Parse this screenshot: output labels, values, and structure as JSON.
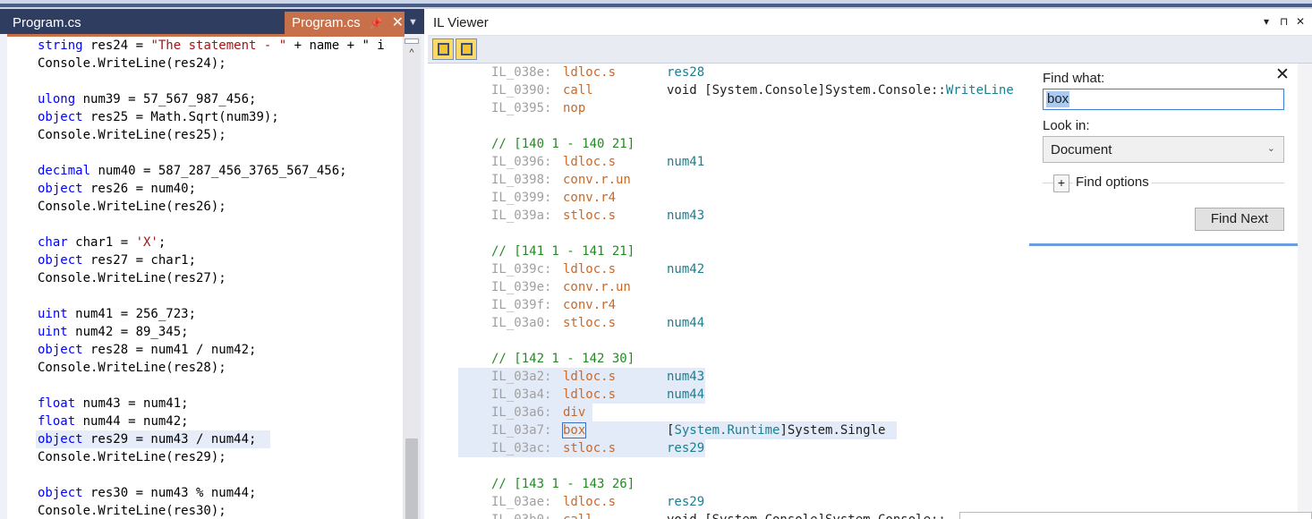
{
  "editor": {
    "tab_left": "Program.cs",
    "tab_active": "Program.cs",
    "lines": [
      {
        "kw": "string",
        "rest": " res24 = ",
        "str": "\"The statement - \"",
        "tail": " + name + \" i"
      },
      {
        "kw": "",
        "rest": "Console.WriteLine(res24);",
        "str": "",
        "tail": ""
      },
      {
        "kw": "",
        "rest": "",
        "str": "",
        "tail": ""
      },
      {
        "kw": "ulong",
        "rest": " num39 = 57_567_987_456;",
        "str": "",
        "tail": ""
      },
      {
        "kw": "object",
        "rest": " res25 = Math.Sqrt(num39);",
        "str": "",
        "tail": ""
      },
      {
        "kw": "",
        "rest": "Console.WriteLine(res25);",
        "str": "",
        "tail": ""
      },
      {
        "kw": "",
        "rest": "",
        "str": "",
        "tail": ""
      },
      {
        "kw": "decimal",
        "rest": " num40 = 587_287_456_3765_567_456;",
        "str": "",
        "tail": ""
      },
      {
        "kw": "object",
        "rest": " res26 = num40;",
        "str": "",
        "tail": ""
      },
      {
        "kw": "",
        "rest": "Console.WriteLine(res26);",
        "str": "",
        "tail": ""
      },
      {
        "kw": "",
        "rest": "",
        "str": "",
        "tail": ""
      },
      {
        "kw": "char",
        "rest": " char1 = ",
        "str": "'X'",
        "tail": ";"
      },
      {
        "kw": "object",
        "rest": " res27 = char1;",
        "str": "",
        "tail": ""
      },
      {
        "kw": "",
        "rest": "Console.WriteLine(res27);",
        "str": "",
        "tail": ""
      },
      {
        "kw": "",
        "rest": "",
        "str": "",
        "tail": ""
      },
      {
        "kw": "uint",
        "rest": " num41 = 256_723;",
        "str": "",
        "tail": ""
      },
      {
        "kw": "uint",
        "rest": " num42 = 89_345;",
        "str": "",
        "tail": ""
      },
      {
        "kw": "object",
        "rest": " res28 = num41 / num42;",
        "str": "",
        "tail": ""
      },
      {
        "kw": "",
        "rest": "Console.WriteLine(res28);",
        "str": "",
        "tail": ""
      },
      {
        "kw": "",
        "rest": "",
        "str": "",
        "tail": ""
      },
      {
        "kw": "float",
        "rest": " num43 = num41;",
        "str": "",
        "tail": ""
      },
      {
        "kw": "float",
        "rest": " num44 = num42;",
        "str": "",
        "tail": ""
      },
      {
        "kw": "object",
        "rest": " res29 = num43 / num44;",
        "str": "",
        "tail": ""
      },
      {
        "kw": "",
        "rest": "Console.WriteLine(res29);",
        "str": "",
        "tail": ""
      },
      {
        "kw": "",
        "rest": "",
        "str": "",
        "tail": ""
      },
      {
        "kw": "object",
        "rest": " res30 = num43 % num44;",
        "str": "",
        "tail": ""
      },
      {
        "kw": "",
        "rest": "Console.WriteLine(res30);",
        "str": "",
        "tail": ""
      }
    ]
  },
  "il_viewer": {
    "title": "IL Viewer",
    "title_controls": [
      "▾",
      "⊓",
      "✕"
    ],
    "lines": [
      {
        "type": "instr",
        "addr": "IL_038e:",
        "op": "ldloc.s",
        "arg": "res28",
        "argkind": "var"
      },
      {
        "type": "instr",
        "addr": "IL_0390:",
        "op": "call",
        "arg": "void [System.Console]System.Console::",
        "arg2": "WriteLine",
        "argkind": "txt"
      },
      {
        "type": "instr",
        "addr": "IL_0395:",
        "op": "nop",
        "arg": "",
        "argkind": "var"
      },
      {
        "type": "blank"
      },
      {
        "type": "comment",
        "text": "// [140 1 - 140 21]"
      },
      {
        "type": "instr",
        "addr": "IL_0396:",
        "op": "ldloc.s",
        "arg": "num41",
        "argkind": "var"
      },
      {
        "type": "instr",
        "addr": "IL_0398:",
        "op": "conv.r.un",
        "arg": "",
        "argkind": "var"
      },
      {
        "type": "instr",
        "addr": "IL_0399:",
        "op": "conv.r4",
        "arg": "",
        "argkind": "var"
      },
      {
        "type": "instr",
        "addr": "IL_039a:",
        "op": "stloc.s",
        "arg": "num43",
        "argkind": "var"
      },
      {
        "type": "blank"
      },
      {
        "type": "comment",
        "text": "// [141 1 - 141 21]"
      },
      {
        "type": "instr",
        "addr": "IL_039c:",
        "op": "ldloc.s",
        "arg": "num42",
        "argkind": "var"
      },
      {
        "type": "instr",
        "addr": "IL_039e:",
        "op": "conv.r.un",
        "arg": "",
        "argkind": "var"
      },
      {
        "type": "instr",
        "addr": "IL_039f:",
        "op": "conv.r4",
        "arg": "",
        "argkind": "var"
      },
      {
        "type": "instr",
        "addr": "IL_03a0:",
        "op": "stloc.s",
        "arg": "num44",
        "argkind": "var"
      },
      {
        "type": "blank"
      },
      {
        "type": "comment",
        "text": "// [142 1 - 142 30]"
      },
      {
        "type": "instr",
        "addr": "IL_03a2:",
        "op": "ldloc.s",
        "arg": "num43",
        "argkind": "var"
      },
      {
        "type": "instr",
        "addr": "IL_03a4:",
        "op": "ldloc.s",
        "arg": "num44",
        "argkind": "var"
      },
      {
        "type": "instr",
        "addr": "IL_03a6:",
        "op": "div",
        "arg": "",
        "argkind": "var"
      },
      {
        "type": "instr",
        "addr": "IL_03a7:",
        "op": "box",
        "arg": "[System.Runtime]System.Single",
        "argkind": "type"
      },
      {
        "type": "instr",
        "addr": "IL_03ac:",
        "op": "stloc.s",
        "arg": "res29",
        "argkind": "var"
      },
      {
        "type": "blank"
      },
      {
        "type": "comment",
        "text": "// [143 1 - 143 26]"
      },
      {
        "type": "instr",
        "addr": "IL_03ae:",
        "op": "ldloc.s",
        "arg": "res29",
        "argkind": "var"
      },
      {
        "type": "instr",
        "addr": "IL_03b0:",
        "op": "call",
        "arg": "void [System.Console]System.Console::",
        "arg2": "",
        "argkind": "txt"
      }
    ]
  },
  "find": {
    "find_what_label": "Find what:",
    "find_what_value": "box",
    "look_in_label": "Look in:",
    "look_in_value": "Document",
    "options_label": "Find options",
    "find_next_label": "Find Next",
    "close_glyph": "✕",
    "expand_glyph": "+"
  },
  "colors": {
    "tab_accent": "#c8704a",
    "keyword": "#0000ff",
    "string": "#a31515",
    "il_opcode": "#c8692a",
    "il_variable": "#1a7f8e",
    "il_comment": "#228b22",
    "selection": "#e4ebf8"
  }
}
